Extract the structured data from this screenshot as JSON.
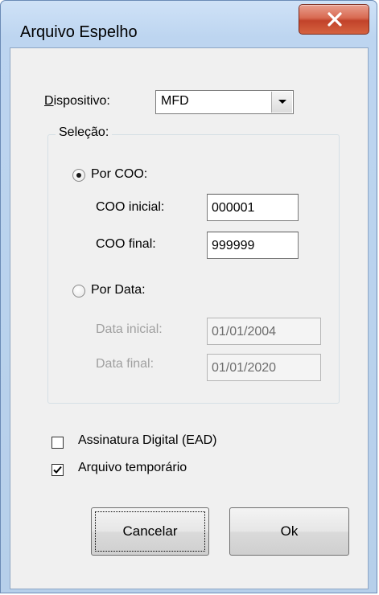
{
  "window": {
    "title": "Arquivo Espelho"
  },
  "dispositivo": {
    "label": "Dispositivo:",
    "value": "MFD"
  },
  "selecao": {
    "title": "Seleção:",
    "por_coo": {
      "label": "Por COO:",
      "selected": true,
      "coo_inicial_label": "COO inicial:",
      "coo_inicial_value": "000001",
      "coo_final_label": "COO final:",
      "coo_final_value": "999999"
    },
    "por_data": {
      "label": "Por Data:",
      "selected": false,
      "data_inicial_label": "Data inicial:",
      "data_inicial_value": "01/01/2004",
      "data_final_label": "Data final:",
      "data_final_value": "01/01/2020"
    }
  },
  "options": {
    "assinatura_label": "Assinatura Digital (EAD)",
    "assinatura_checked": false,
    "temporario_label": "Arquivo temporário",
    "temporario_checked": true
  },
  "buttons": {
    "cancel_label": "Cancelar",
    "ok_label": "Ok"
  }
}
